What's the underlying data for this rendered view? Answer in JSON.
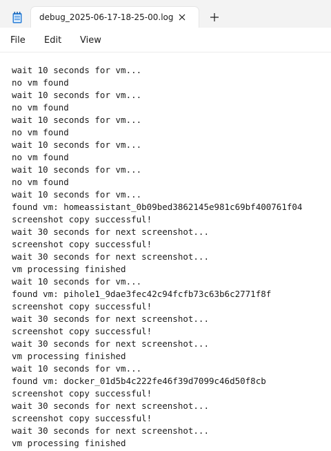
{
  "tab": {
    "title": "debug_2025-06-17-18-25-00.log",
    "icon": "notepad-icon",
    "close_icon": "close-icon",
    "new_tab_icon": "plus-icon"
  },
  "menu": {
    "file": "File",
    "edit": "Edit",
    "view": "View"
  },
  "log_lines": [
    "wait 10 seconds for vm...",
    "no vm found",
    "wait 10 seconds for vm...",
    "no vm found",
    "wait 10 seconds for vm...",
    "no vm found",
    "wait 10 seconds for vm...",
    "no vm found",
    "wait 10 seconds for vm...",
    "no vm found",
    "wait 10 seconds for vm...",
    "found vm: homeassistant_0b09bed3862145e981c69bf400761f04",
    "screenshot copy successful!",
    "wait 30 seconds for next screenshot...",
    "screenshot copy successful!",
    "wait 30 seconds for next screenshot...",
    "vm processing finished",
    "wait 10 seconds for vm...",
    "found vm: pihole1_9dae3fec42c94fcfb73c63b6c2771f8f",
    "screenshot copy successful!",
    "wait 30 seconds for next screenshot...",
    "screenshot copy successful!",
    "wait 30 seconds for next screenshot...",
    "vm processing finished",
    "wait 10 seconds for vm...",
    "found vm: docker_01d5b4c222fe46f39d7099c46d50f8cb",
    "screenshot copy successful!",
    "wait 30 seconds for next screenshot...",
    "screenshot copy successful!",
    "wait 30 seconds for next screenshot...",
    "vm processing finished"
  ]
}
